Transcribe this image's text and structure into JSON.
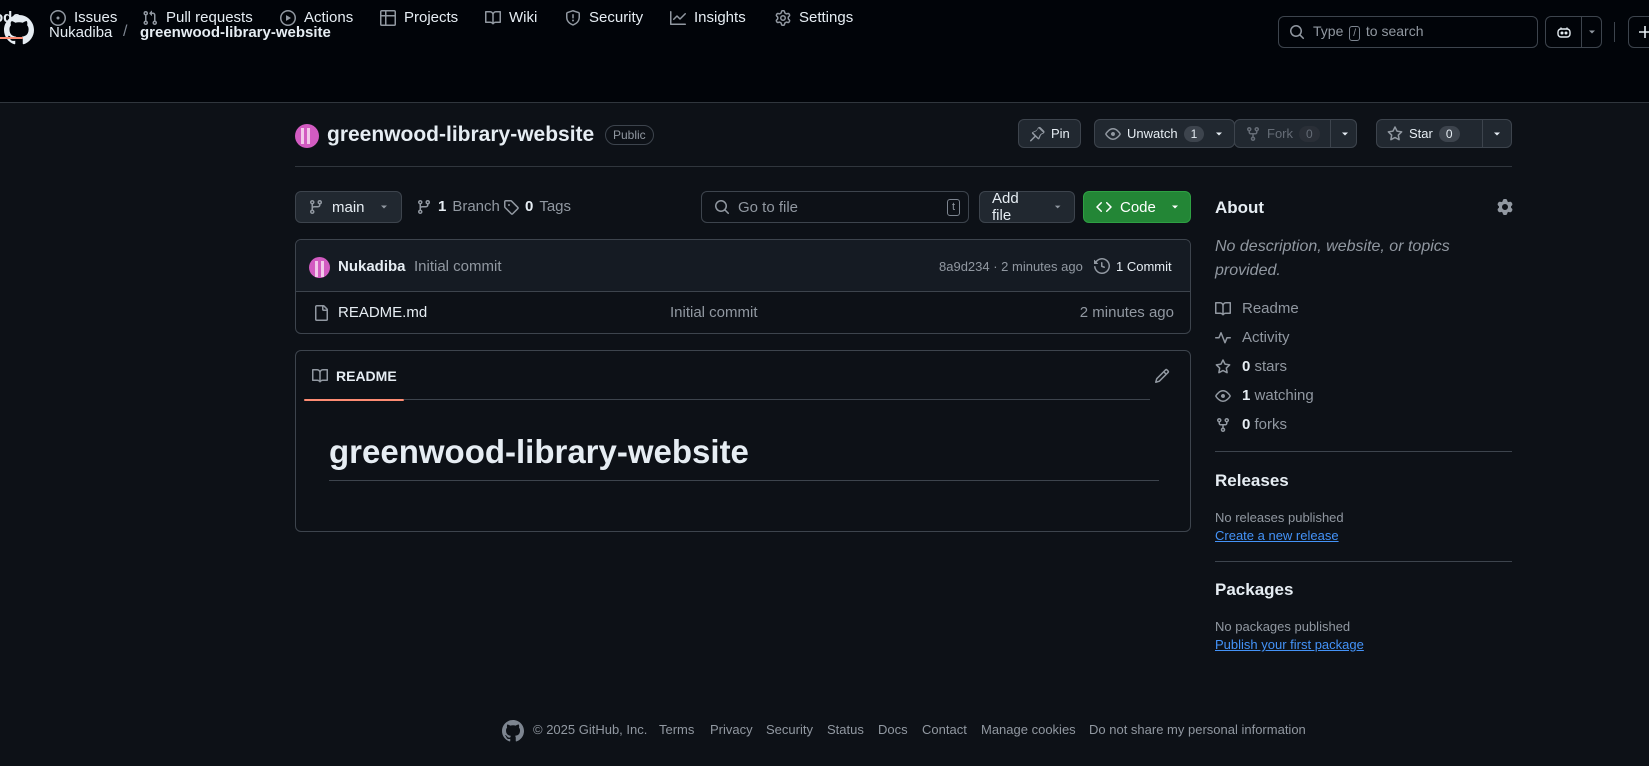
{
  "header": {
    "owner": "Nukadiba",
    "separator": "/",
    "repo": "greenwood-library-website",
    "search": {
      "pre": "Type",
      "key": "/",
      "post": "to search"
    }
  },
  "tabs": [
    {
      "label": "Code",
      "icon": "code-icon",
      "active": true
    },
    {
      "label": "Issues",
      "icon": "issue-icon"
    },
    {
      "label": "Pull requests",
      "icon": "pull-request-icon"
    },
    {
      "label": "Actions",
      "icon": "play-icon"
    },
    {
      "label": "Projects",
      "icon": "table-icon"
    },
    {
      "label": "Wiki",
      "icon": "book-icon"
    },
    {
      "label": "Security",
      "icon": "shield-icon"
    },
    {
      "label": "Insights",
      "icon": "graph-icon"
    },
    {
      "label": "Settings",
      "icon": "gear-icon"
    }
  ],
  "tab_code_visible_text": "ode",
  "repo_header": {
    "title": "greenwood-library-website",
    "visibility": "Public",
    "pin_label": "Pin",
    "unwatch_label": "Unwatch",
    "watch_count": "1",
    "fork_label": "Fork",
    "fork_count": "0",
    "star_label": "Star",
    "star_count": "0"
  },
  "file_nav": {
    "branch": "main",
    "branch_count": "1",
    "branch_label": "Branch",
    "tag_count": "0",
    "tag_label": "Tags",
    "goto_placeholder": "Go to file",
    "goto_key": "t",
    "add_file": "Add file",
    "code_button": "Code"
  },
  "latest_commit": {
    "author": "Nukadiba",
    "message": "Initial commit",
    "meta": "8a9d234 · 2 minutes ago",
    "commit_count": "1 Commit"
  },
  "files": [
    {
      "name": "README.md",
      "message": "Initial commit",
      "time": "2 minutes ago"
    }
  ],
  "readme": {
    "tab_label": "README",
    "heading": "greenwood-library-website"
  },
  "about": {
    "title": "About",
    "description": "No description, website, or topics provided.",
    "items": [
      {
        "icon": "book-icon",
        "count": "",
        "label": "Readme"
      },
      {
        "icon": "pulse-icon",
        "count": "",
        "label": "Activity"
      },
      {
        "icon": "star-icon",
        "count": "0",
        "label": "stars"
      },
      {
        "icon": "eye-icon",
        "count": "1",
        "label": "watching"
      },
      {
        "icon": "fork-icon",
        "count": "0",
        "label": "forks"
      }
    ]
  },
  "releases": {
    "title": "Releases",
    "empty_text": "No releases published",
    "link": "Create a new release"
  },
  "packages": {
    "title": "Packages",
    "empty_text": "No packages published",
    "link": "Publish your first package"
  },
  "footer": {
    "copyright": "© 2025 GitHub, Inc.",
    "links": [
      "Terms",
      "Privacy",
      "Security",
      "Status",
      "Docs",
      "Contact",
      "Manage cookies",
      "Do not share my personal information"
    ]
  },
  "colors": {
    "background": "#0d1117",
    "accent_tab": "#fd8c73",
    "code_button": "#238636",
    "link": "#4493f8"
  }
}
